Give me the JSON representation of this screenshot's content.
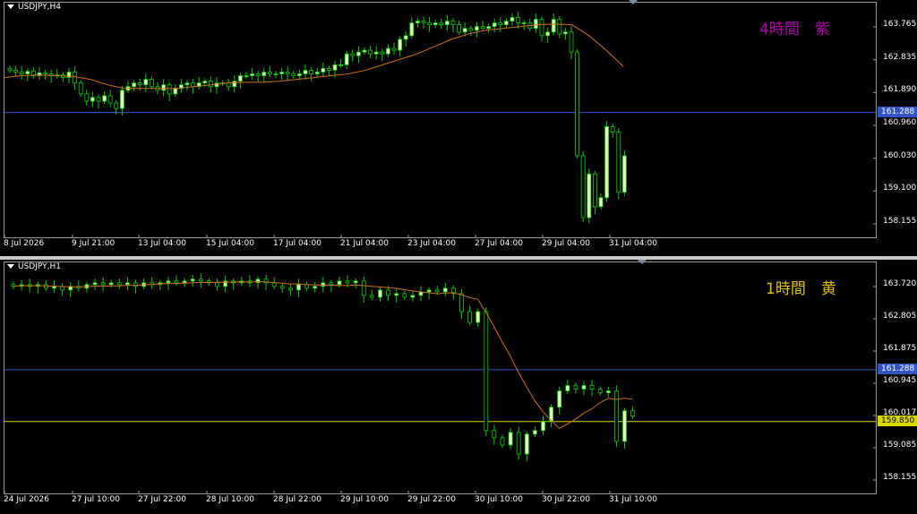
{
  "top_chart": {
    "symbol": "USDJPY,H4",
    "timeframe_label": "4時間　紫",
    "timeframe_color": "#b000b0",
    "price_ticks": [
      "163.765",
      "162.835",
      "161.890",
      "160.960",
      "160.030",
      "159.100",
      "158.155"
    ],
    "horizontal_line_label": "161.288",
    "horizontal_line_color": "#2f55c8",
    "time_ticks": [
      "8 Jul 2026",
      "9 Jul 21:00",
      "13 Jul 04:00",
      "15 Jul 04:00",
      "17 Jul 04:00",
      "21 Jul 04:00",
      "23 Jul 04:00",
      "27 Jul 04:00",
      "29 Jul 04:00",
      "31 Jul 04:00"
    ]
  },
  "bottom_chart": {
    "symbol": "USDJPY,H1",
    "timeframe_label": "1時間　黄",
    "timeframe_color": "#e0c000",
    "price_ticks": [
      "163.720",
      "162.805",
      "161.875",
      "160.945",
      "160.017",
      "159.085",
      "158.155"
    ],
    "horizontal_line_label": "161.288",
    "horizontal_line_color": "#2f55c8",
    "current_price_label": "159.850",
    "current_price_color": "#d8d800",
    "time_ticks": [
      "24 Jul 2026",
      "27 Jul 10:00",
      "27 Jul 22:00",
      "28 Jul 10:00",
      "28 Jul 22:00",
      "29 Jul 10:00",
      "29 Jul 22:00",
      "30 Jul 10:00",
      "30 Jul 22:00",
      "31 Jul 10:00"
    ]
  },
  "colors": {
    "background": "#000000",
    "candle_bull": "#e8ffc0",
    "candle_bear": "#000000",
    "candle_wick": "#00d000",
    "moving_average": "#d07010",
    "axis_text": "#ffffff"
  },
  "chart_data": [
    {
      "type": "candlestick",
      "title": "USDJPY,H4",
      "ylim": [
        158.155,
        163.765
      ],
      "horizontal_line": 161.288,
      "closes": [
        162.45,
        162.4,
        162.35,
        162.42,
        162.3,
        162.38,
        162.35,
        162.3,
        162.32,
        162.25,
        162.4,
        162.1,
        161.8,
        161.6,
        161.7,
        161.6,
        161.75,
        161.55,
        161.4,
        161.9,
        162.0,
        162.1,
        162.05,
        162.2,
        162.0,
        161.9,
        162.05,
        161.8,
        161.95,
        162.05,
        162.1,
        162.0,
        162.1,
        162.15,
        162.0,
        162.1,
        162.1,
        162.0,
        162.15,
        162.3,
        162.3,
        162.35,
        162.3,
        162.4,
        162.35,
        162.35,
        162.4,
        162.35,
        162.3,
        162.35,
        162.45,
        162.35,
        162.4,
        162.5,
        162.45,
        162.6,
        162.6,
        162.9,
        162.85,
        162.95,
        163.0,
        162.9,
        162.95,
        162.9,
        163.05,
        163.0,
        163.3,
        163.4,
        163.75,
        163.8,
        163.75,
        163.7,
        163.75,
        163.7,
        163.8,
        163.7,
        163.5,
        163.6,
        163.55,
        163.65,
        163.6,
        163.65,
        163.75,
        163.7,
        163.8,
        163.9,
        163.75,
        163.75,
        163.6,
        163.85,
        163.4,
        163.5,
        163.85,
        163.45,
        163.5,
        162.95,
        160.1,
        158.4,
        159.6,
        158.7,
        158.95,
        160.9,
        160.75,
        159.1,
        160.1
      ],
      "ma": [
        162.25,
        162.3,
        162.32,
        162.3,
        162.28,
        162.2,
        162.05,
        161.95,
        161.95,
        161.95,
        161.95,
        162.0,
        162.05,
        162.1,
        162.12,
        162.12,
        162.15,
        162.2,
        162.25,
        162.3,
        162.35,
        162.45,
        162.6,
        162.75,
        162.9,
        163.1,
        163.3,
        163.45,
        163.55,
        163.6,
        163.65,
        163.7,
        163.72,
        163.7,
        163.4,
        163.0,
        162.55
      ]
    },
    {
      "type": "candlestick",
      "title": "USDJPY,H1",
      "ylim": [
        158.155,
        163.72
      ],
      "horizontal_line": 161.288,
      "current_price": 159.85,
      "closes": [
        163.6,
        163.65,
        163.6,
        163.65,
        163.55,
        163.6,
        163.5,
        163.6,
        163.55,
        163.65,
        163.7,
        163.65,
        163.7,
        163.65,
        163.7,
        163.6,
        163.7,
        163.65,
        163.7,
        163.75,
        163.7,
        163.75,
        163.8,
        163.75,
        163.7,
        163.6,
        163.75,
        163.7,
        163.75,
        163.7,
        163.8,
        163.7,
        163.6,
        163.55,
        163.5,
        163.65,
        163.55,
        163.6,
        163.7,
        163.65,
        163.75,
        163.7,
        163.75,
        163.35,
        163.3,
        163.5,
        163.35,
        163.4,
        163.3,
        163.35,
        163.45,
        163.5,
        163.45,
        163.55,
        163.4,
        162.9,
        162.6,
        162.9,
        159.6,
        159.4,
        159.2,
        159.55,
        158.95,
        159.5,
        159.6,
        159.85,
        160.25,
        160.7,
        160.85,
        160.75,
        160.85,
        160.75,
        160.65,
        160.7,
        159.3,
        160.15,
        160.0
      ]
    }
  ]
}
